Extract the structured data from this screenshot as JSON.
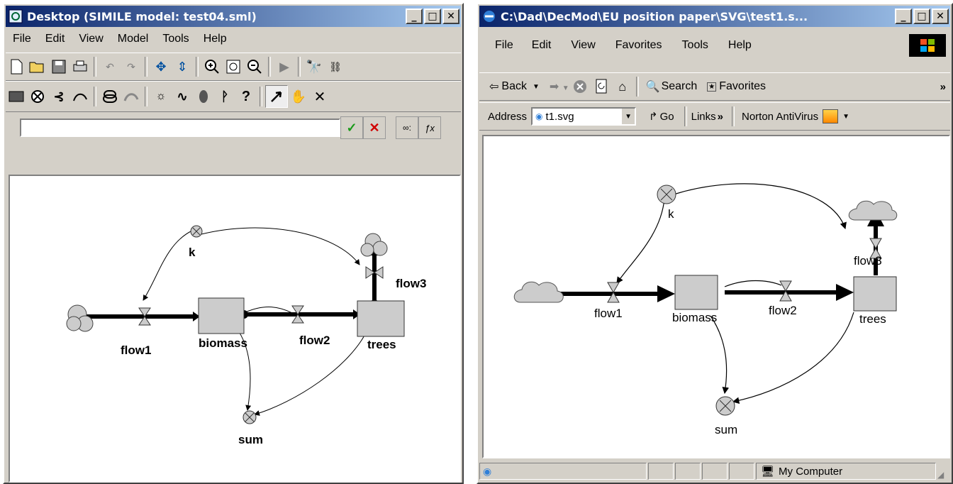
{
  "left_window": {
    "title": "Desktop (SIMILE model: test04.sml)",
    "menu": [
      "File",
      "Edit",
      "View",
      "Model",
      "Tools",
      "Help"
    ],
    "menu_underline": [
      "F",
      "E",
      "V",
      "M",
      "T",
      "H"
    ],
    "toolbar1_icons": [
      "new-icon",
      "open-icon",
      "save-icon",
      "print-icon",
      "undo-icon",
      "redo-icon",
      "move-icon",
      "resize-icon",
      "zoom-in-icon",
      "zoom-fit-icon",
      "zoom-out-icon",
      "run-icon",
      "find-icon",
      "replace-icon"
    ],
    "toolbar2_icons": [
      "compartment-icon",
      "variable-icon",
      "flow-icon",
      "influence-icon",
      "submodel-icon",
      "role-arrow-icon",
      "event-icon",
      "alarm-icon",
      "condition-icon",
      "parameter-icon",
      "help-icon",
      "pointer-icon",
      "hand-icon",
      "delete-icon"
    ],
    "equation_value": "",
    "diagram": {
      "k": "k",
      "flow1": "flow1",
      "biomass": "biomass",
      "flow2": "flow2",
      "trees": "trees",
      "flow3": "flow3",
      "sum": "sum"
    }
  },
  "right_window": {
    "title": "C:\\Dad\\DecMod\\EU position paper\\SVG\\test1.s...",
    "menu": [
      "File",
      "Edit",
      "View",
      "Favorites",
      "Tools",
      "Help"
    ],
    "nav": {
      "back": "Back",
      "search": "Search",
      "favorites": "Favorites"
    },
    "address_label": "Address",
    "address_value": "t1.svg",
    "go_label": "Go",
    "links_label": "Links",
    "norton_label": "Norton AntiVirus",
    "status_zone": "My Computer",
    "diagram": {
      "k": "k",
      "flow1": "flow1",
      "biomass": "biomass",
      "flow2": "flow2",
      "trees": "trees",
      "flow3": "flow3",
      "sum": "sum"
    }
  }
}
